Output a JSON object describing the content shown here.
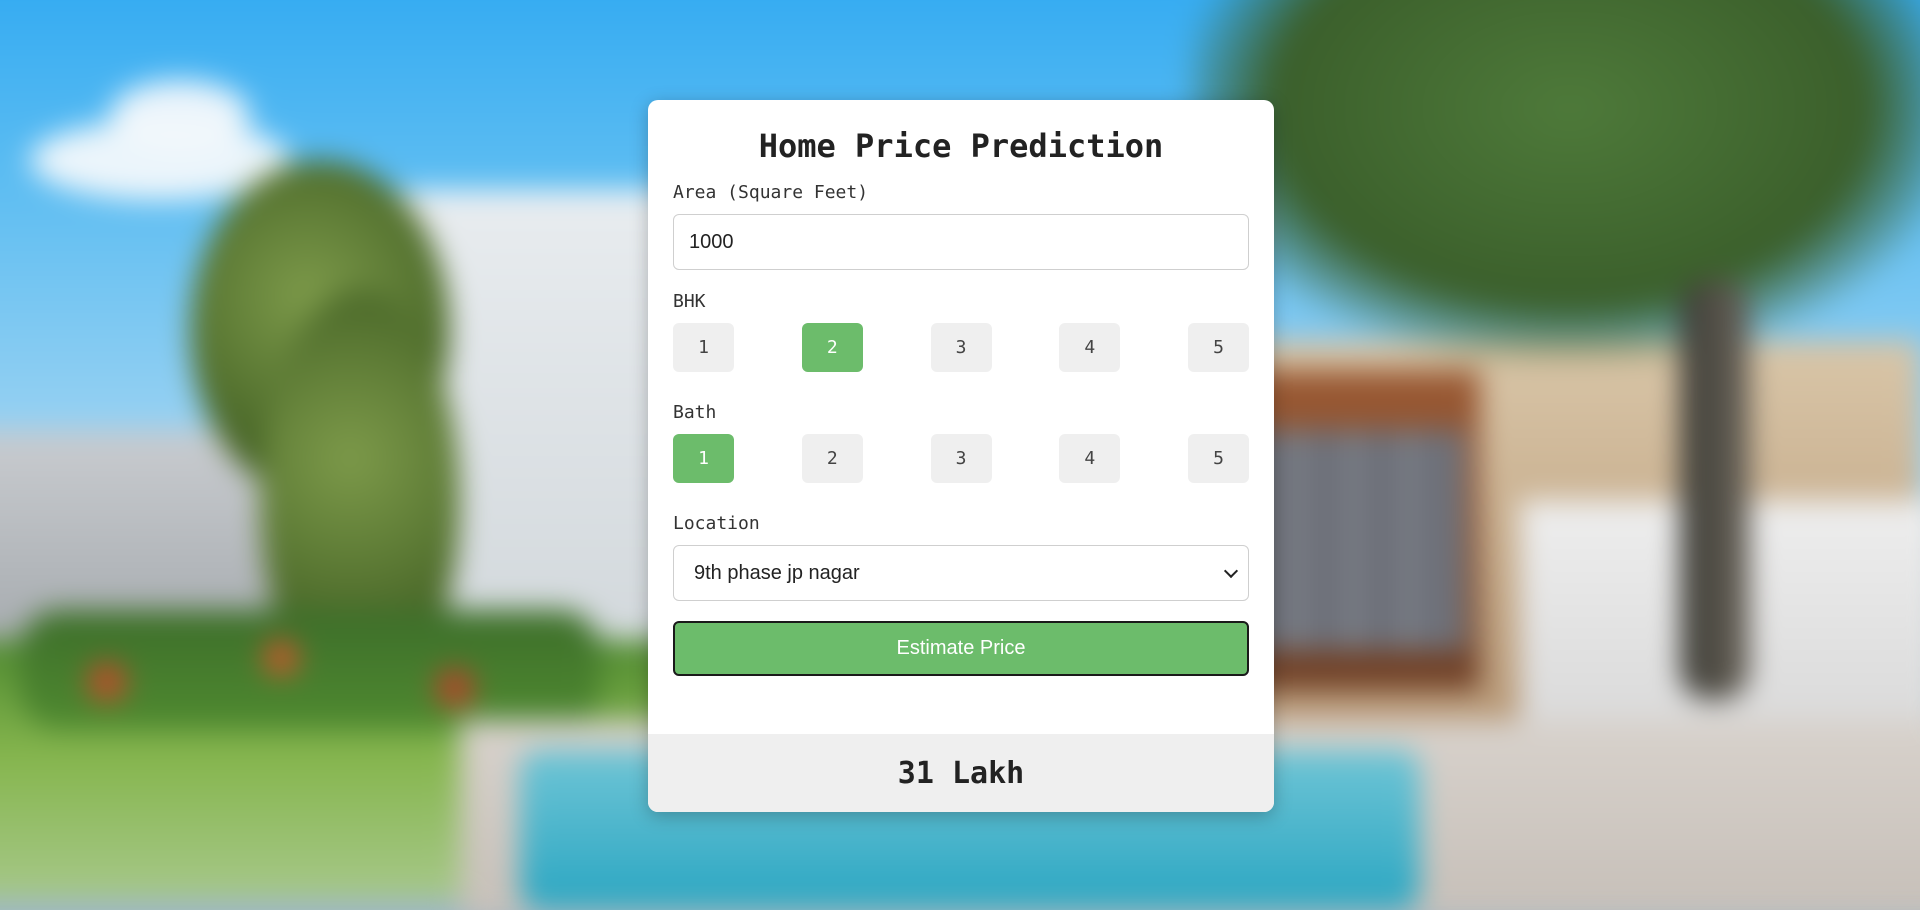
{
  "form": {
    "title": "Home Price Prediction",
    "area_label": "Area (Square Feet)",
    "area_value": "1000",
    "bhk_label": "BHK",
    "bhk_options": [
      "1",
      "2",
      "3",
      "4",
      "5"
    ],
    "bhk_selected": "2",
    "bath_label": "Bath",
    "bath_options": [
      "1",
      "2",
      "3",
      "4",
      "5"
    ],
    "bath_selected": "1",
    "location_label": "Location",
    "location_value": "9th phase jp nagar",
    "estimate_button": "Estimate Price",
    "result": "31 Lakh"
  },
  "colors": {
    "accent": "#6cbc6b",
    "option_bg": "#efefef",
    "result_bg": "#efefef"
  }
}
